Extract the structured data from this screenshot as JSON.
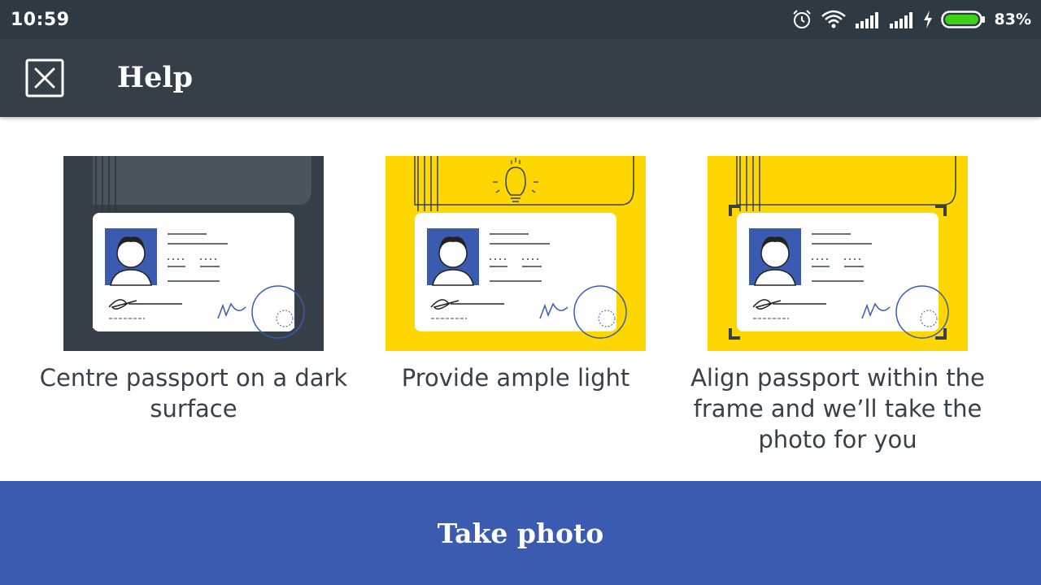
{
  "status_bar": {
    "time": "10:59",
    "battery_percent": "83%",
    "battery_level": 0.83,
    "icons": [
      "alarm-icon",
      "wifi-icon",
      "signal-icon",
      "signal-icon",
      "charging-icon",
      "battery-icon"
    ]
  },
  "app_bar": {
    "title": "Help",
    "close_icon": "close-icon"
  },
  "tips": [
    {
      "caption": "Centre passport on a dark surface",
      "background": "#363f48",
      "illustration": "passport-dark-surface"
    },
    {
      "caption": "Provide ample light",
      "background": "#ffd600",
      "illustration": "passport-lightbulb"
    },
    {
      "caption": "Align passport within the frame and we’ll take the photo for you",
      "background": "#ffd600",
      "illustration": "passport-frame"
    }
  ],
  "action": {
    "label": "Take photo"
  },
  "colors": {
    "status_bar": "#2f3942",
    "app_bar": "#363f48",
    "accent_yellow": "#ffd600",
    "primary_button": "#3a5baf",
    "text": "#36414b",
    "battery_green": "#3ecf19"
  }
}
